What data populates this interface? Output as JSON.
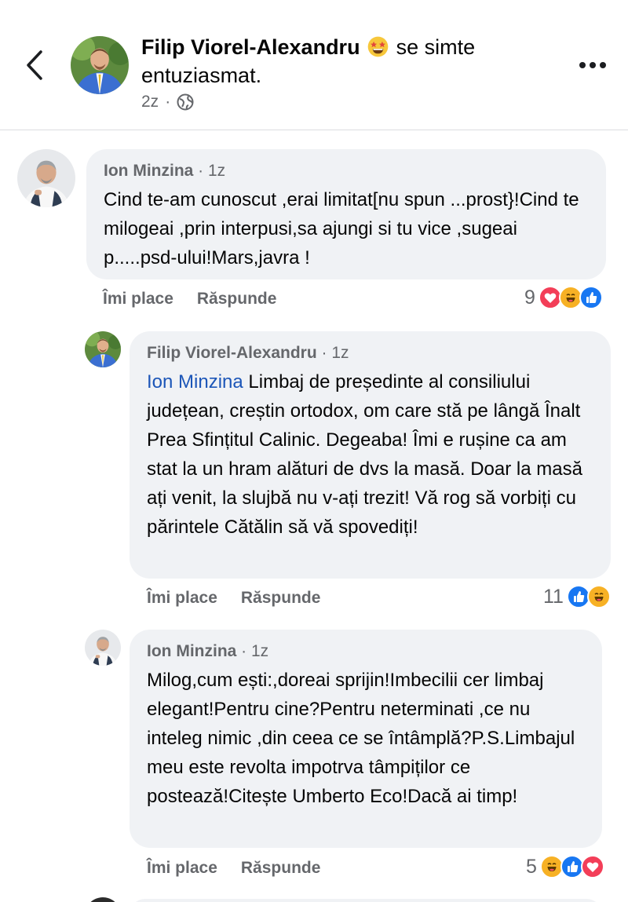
{
  "post": {
    "author": "Filip Viorel-Alexandru",
    "feeling_text": "se simte entuziasmat.",
    "time": "2z",
    "separator": "·"
  },
  "icons": {
    "back": "chevron-left-icon",
    "more": "more-horizontal-icon",
    "audience": "globe-icon",
    "reactions": [
      "like-icon",
      "love-icon",
      "haha-icon"
    ]
  },
  "colors": {
    "bubble": "#f0f2f5",
    "mention": "#1c56b8",
    "like": "#1877f2",
    "love": "#f33e58",
    "haha": "#f7b125",
    "muted": "#65676b"
  },
  "comments": [
    {
      "author": "Ion Minzina",
      "time": "· 1z",
      "text": "Cind te-am cunoscut ,erai limitat[nu spun ...prost}!Cind te milogeai ,prin interpusi,sa ajungi si tu vice ,sugeai p.....psd-ului!Mars,javra !",
      "like_label": "Îmi place",
      "reply_label": "Răspunde",
      "reaction_count": "9"
    },
    {
      "author": "Filip Viorel-Alexandru",
      "time": "· 1z",
      "mention": "Ion Minzina",
      "text": " Limbaj de președinte al consiliului județean, creștin ortodox, om care stă pe lângă Înalt Prea Sfințitul Calinic. Degeaba! Îmi e rușine ca am stat la un hram alături de dvs la masă. Doar la masă ați venit, la slujbă nu v-ați trezit! Vă rog să vorbiți cu părintele Cătălin să vă spovediți!",
      "like_label": "Îmi place",
      "reply_label": "Răspunde",
      "reaction_count": "11"
    },
    {
      "author": "Ion Minzina",
      "time": "· 1z",
      "text": "Milog,cum ești:,doreai sprijin!Imbecilii cer limbaj elegant!Pentru cine?Pentru neterminati ,ce nu inteleg nimic ,din ceea ce se întâmplă?P.S.Limbajul meu este revolta impotrva tâmpiților ce postează!Citește Umberto  Eco!Dacă ai timp!",
      "like_label": "Îmi place",
      "reply_label": "Răspunde",
      "reaction_count": "5"
    }
  ]
}
